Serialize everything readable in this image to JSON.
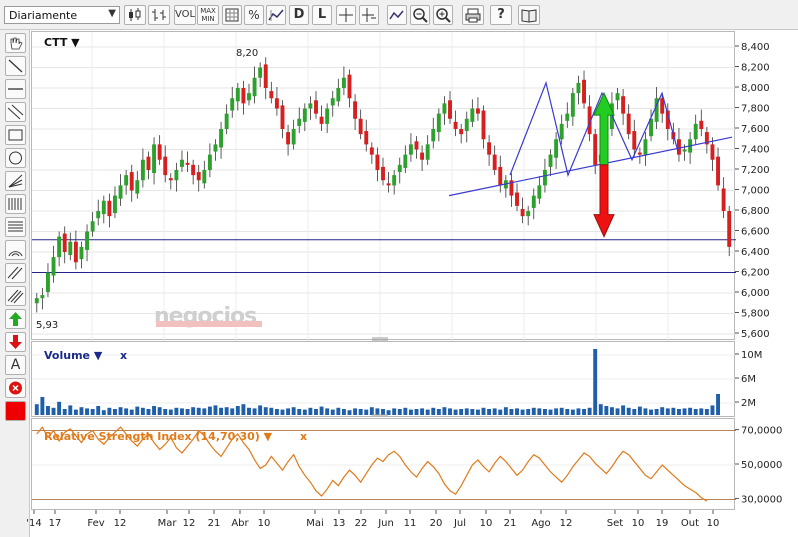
{
  "toolbar": {
    "period_select": "Diariamente",
    "vol_label": "VOL",
    "maxmin_label_1": "MAX",
    "maxmin_label_2": "MIN",
    "percent_label": "%",
    "daily_label": "D",
    "linear_label": "L"
  },
  "main_chart": {
    "symbol": "CTT ▼",
    "high_label": "8,20",
    "low_label": "5,93",
    "watermark": "negocios",
    "y_ticks": [
      "8,400",
      "8,200",
      "8,000",
      "7,800",
      "7,600",
      "7,400",
      "7,200",
      "7,000",
      "6,800",
      "6,600",
      "6,400",
      "6,200",
      "6,000",
      "5,800",
      "5,600"
    ]
  },
  "volume_panel": {
    "title": "Volume ▼",
    "close": "x",
    "y_ticks": [
      "10M",
      "6M",
      "2M"
    ]
  },
  "rsi_panel": {
    "title": "Relative Strength Index (14,70,30) ▼",
    "close": "x",
    "y_ticks": [
      "70,0000",
      "50,0000",
      "30,0000"
    ]
  },
  "x_axis": {
    "labels": [
      "'14",
      "17",
      "Fev",
      "12",
      "Mar",
      "12",
      "21",
      "Abr",
      "10",
      "Mai",
      "13",
      "22",
      "Jun",
      "11",
      "20",
      "Jul",
      "10",
      "21",
      "Ago",
      "12",
      "Set",
      "10",
      "19",
      "Out",
      "10"
    ]
  },
  "colors": {
    "up": "#2ea02e",
    "down": "#d62020",
    "trendline": "#3a3ad0",
    "hline": "#23238a",
    "volume": "#1f5faa",
    "rsi": "#e07a1a",
    "arrow_up": "#22cc22",
    "arrow_down": "#ee1111"
  },
  "chart_data": [
    {
      "type": "candlestick",
      "title": "CTT",
      "ylim": [
        5.6,
        8.4
      ],
      "grid": true,
      "annotations": [
        "8,20",
        "5,93"
      ],
      "horizontal_levels": [
        6.52,
        6.2
      ],
      "close": [
        5.95,
        5.98,
        6.2,
        6.35,
        6.55,
        6.4,
        6.5,
        6.3,
        6.45,
        6.6,
        6.7,
        6.8,
        6.9,
        6.75,
        6.95,
        7.05,
        7.15,
        7.0,
        7.1,
        7.3,
        7.2,
        7.45,
        7.3,
        7.15,
        7.1,
        7.2,
        7.3,
        7.25,
        7.15,
        7.1,
        7.2,
        7.35,
        7.45,
        7.6,
        7.75,
        7.9,
        8.0,
        7.85,
        7.95,
        8.1,
        8.2,
        8.0,
        7.9,
        7.8,
        7.6,
        7.45,
        7.6,
        7.7,
        7.8,
        7.85,
        7.75,
        7.65,
        7.8,
        7.9,
        8.0,
        8.1,
        7.9,
        7.7,
        7.55,
        7.45,
        7.35,
        7.2,
        7.1,
        7.05,
        7.15,
        7.25,
        7.35,
        7.45,
        7.4,
        7.3,
        7.45,
        7.6,
        7.75,
        7.85,
        7.7,
        7.6,
        7.55,
        7.7,
        7.8,
        7.75,
        7.5,
        7.35,
        7.2,
        7.05,
        7.1,
        6.95,
        6.85,
        6.75,
        6.8,
        6.95,
        7.05,
        7.2,
        7.35,
        7.5,
        7.65,
        7.75,
        7.95,
        8.05,
        7.85,
        7.55,
        7.25,
        7.35,
        7.6,
        7.85,
        7.95,
        7.75,
        7.55,
        7.4,
        7.35,
        7.5,
        7.7,
        7.9,
        7.75,
        7.6,
        7.5,
        7.35,
        7.4,
        7.5,
        7.65,
        7.6,
        7.45,
        7.3,
        7.05,
        6.8,
        6.45
      ]
    },
    {
      "type": "bar",
      "title": "Volume",
      "ylim": [
        0,
        11
      ],
      "values": [
        1.8,
        3.0,
        1.5,
        1.2,
        2.2,
        1.0,
        1.6,
        0.9,
        1.3,
        1.1,
        1.0,
        1.5,
        0.8,
        1.2,
        1.0,
        1.3,
        1.1,
        0.9,
        1.4,
        1.2,
        1.0,
        1.5,
        1.3,
        1.0,
        0.9,
        1.2,
        1.1,
        1.0,
        1.3,
        1.2,
        1.1,
        1.4,
        1.6,
        1.2,
        1.3,
        1.1,
        1.5,
        1.8,
        1.2,
        1.1,
        1.6,
        1.3,
        1.2,
        1.0,
        0.9,
        1.1,
        1.3,
        1.0,
        0.9,
        1.2,
        1.0,
        1.4,
        1.1,
        0.9,
        1.2,
        1.0,
        0.8,
        1.1,
        1.0,
        0.9,
        1.3,
        1.1,
        1.0,
        0.8,
        1.1,
        1.0,
        1.2,
        0.9,
        1.0,
        1.1,
        0.9,
        1.2,
        1.0,
        1.3,
        1.1,
        0.9,
        1.0,
        1.1,
        1.0,
        0.9,
        1.2,
        1.0,
        1.1,
        0.9,
        1.3,
        1.0,
        1.1,
        0.9,
        1.0,
        1.2,
        1.1,
        1.0,
        0.9,
        1.1,
        1.2,
        1.0,
        0.9,
        1.1,
        1.0,
        1.2,
        11.0,
        1.8,
        1.5,
        1.3,
        1.1,
        1.6,
        1.2,
        1.0,
        1.4,
        1.1,
        0.9,
        1.0,
        1.3,
        1.1,
        1.2,
        1.0,
        1.1,
        1.2,
        1.0,
        1.1,
        1.0,
        1.6,
        3.5
      ]
    },
    {
      "type": "line",
      "title": "Relative Strength Index (14,70,30)",
      "ylim": [
        25,
        75
      ],
      "levels": [
        70,
        30
      ],
      "values": [
        68,
        72,
        66,
        70,
        64,
        69,
        71,
        67,
        63,
        68,
        70,
        65,
        62,
        66,
        69,
        72,
        68,
        64,
        61,
        65,
        68,
        63,
        59,
        62,
        66,
        60,
        57,
        61,
        65,
        70,
        67,
        62,
        58,
        55,
        60,
        65,
        68,
        63,
        59,
        53,
        48,
        50,
        55,
        51,
        47,
        52,
        56,
        49,
        44,
        40,
        35,
        32,
        36,
        41,
        38,
        43,
        47,
        44,
        40,
        45,
        50,
        54,
        52,
        56,
        58,
        55,
        50,
        46,
        43,
        48,
        52,
        49,
        45,
        39,
        35,
        33,
        38,
        44,
        50,
        53,
        49,
        46,
        51,
        55,
        52,
        48,
        44,
        47,
        52,
        56,
        54,
        50,
        46,
        43,
        40,
        44,
        49,
        53,
        57,
        55,
        51,
        48,
        45,
        49,
        54,
        58,
        56,
        52,
        48,
        44,
        42,
        46,
        50,
        47,
        44,
        41,
        38,
        36,
        34,
        31,
        29
      ]
    }
  ]
}
